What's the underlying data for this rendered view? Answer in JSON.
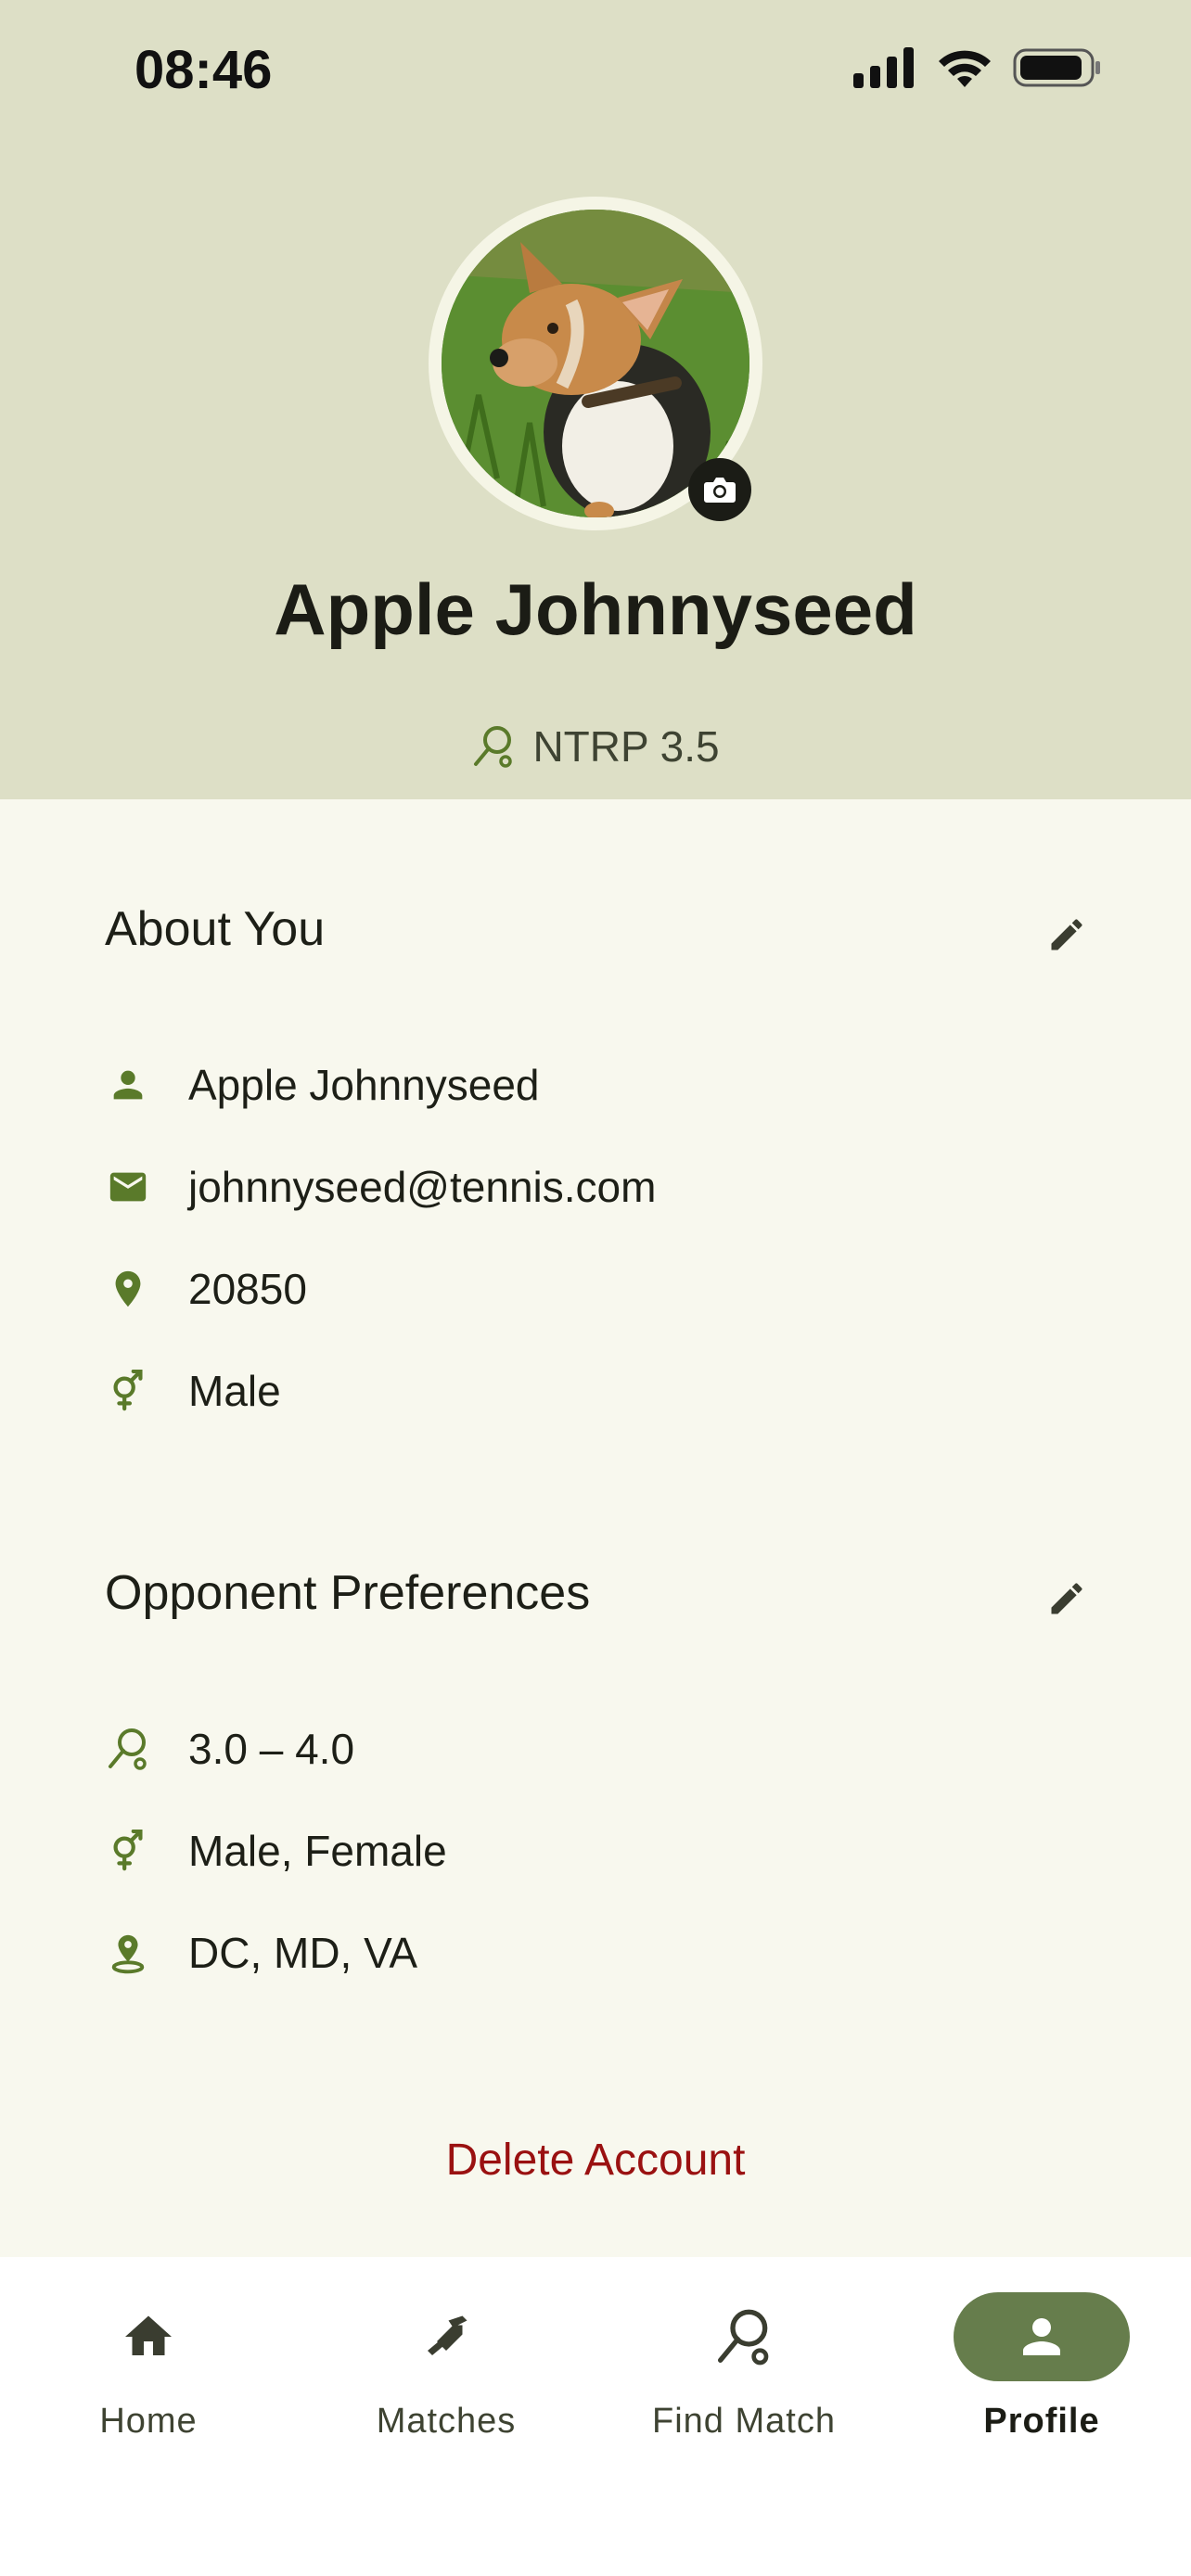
{
  "status_bar": {
    "time": "08:46"
  },
  "profile": {
    "name": "Apple Johnnyseed",
    "rating": "NTRP 3.5"
  },
  "about": {
    "title": "About You",
    "items": [
      {
        "icon": "person-icon",
        "text": "Apple Johnnyseed"
      },
      {
        "icon": "mail-icon",
        "text": "johnnyseed@tennis.com"
      },
      {
        "icon": "location-pin-icon",
        "text": "20850"
      },
      {
        "icon": "gender-icon",
        "text": "Male"
      }
    ]
  },
  "preferences": {
    "title": "Opponent Preferences",
    "items": [
      {
        "icon": "racket-icon",
        "text": "3.0 – 4.0"
      },
      {
        "icon": "gender-icon",
        "text": "Male, Female"
      },
      {
        "icon": "location-area-icon",
        "text": "DC, MD, VA"
      }
    ]
  },
  "delete_label": "Delete Account",
  "nav": {
    "items": [
      {
        "label": "Home",
        "icon": "home-icon"
      },
      {
        "label": "Matches",
        "icon": "matches-icon"
      },
      {
        "label": "Find Match",
        "icon": "racket-icon"
      },
      {
        "label": "Profile",
        "icon": "person-icon",
        "active": true
      }
    ]
  },
  "colors": {
    "header_bg": "#dddfc6",
    "page_bg": "#f8f8ee",
    "accent": "#5a7a2a",
    "active_pill": "#667d4c",
    "danger": "#9a1111"
  }
}
